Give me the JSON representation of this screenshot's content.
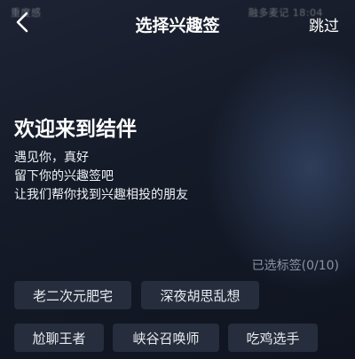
{
  "status_bar": {
    "left_text": "重度感",
    "right_text": "融多麦记 18:04"
  },
  "header": {
    "back_icon": "chevron-left-icon",
    "title": "选择兴趣签",
    "skip_label": "跳过"
  },
  "welcome": {
    "title": "欢迎来到结伴",
    "lines": [
      "遇见你，真好",
      "留下你的兴趣签吧",
      "让我们帮你找到兴趣相投的朋友"
    ]
  },
  "tags": {
    "selected_count_label": "已选标签(0/10)",
    "selected": 0,
    "max": 10,
    "items": [
      {
        "label": "老二次元肥宅"
      },
      {
        "label": "深夜胡思乱想"
      },
      {
        "label": "尬聊王者"
      },
      {
        "label": "峡谷召唤师"
      },
      {
        "label": "吃鸡选手"
      }
    ]
  },
  "colors": {
    "background": "#141a27",
    "tag_background": "#262d3c",
    "muted_text": "#8a92a3"
  }
}
